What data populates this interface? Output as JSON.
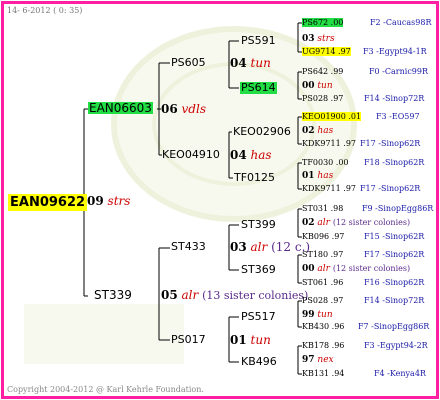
{
  "header": {
    "date": "14- 6-2012 ( 0: 35)"
  },
  "footer": {
    "copyright": "Copyright 2004-2012 @ Karl Kehrle Foundation."
  },
  "root": {
    "code": "EAN09622",
    "num": "09",
    "abbr": "strs"
  },
  "sire": {
    "code": "EAN06603",
    "num": "06",
    "abbr": "vdls"
  },
  "dam": {
    "code": "ST339",
    "num": "05",
    "abbr": "alr",
    "note": "(13 sister colonies)"
  },
  "ss": {
    "code": "PS605",
    "num": "04",
    "abbr": "tun"
  },
  "sd": {
    "code": "KEO04910",
    "num": "04",
    "abbr": "has"
  },
  "ds": {
    "code": "ST433",
    "num": "03",
    "abbr": "alr",
    "note": "(12 c.)"
  },
  "dd": {
    "code": "PS017",
    "num": "01",
    "abbr": "tun"
  },
  "g3": {
    "a": {
      "code": "PS591",
      "num": "03",
      "abbr": "strs"
    },
    "b": {
      "code": "PS614",
      "num": "00",
      "abbr": "tun"
    },
    "c": {
      "code": "KEO02906",
      "num": "02",
      "abbr": "has"
    },
    "d": {
      "code": "TF0125",
      "num": "01",
      "abbr": "has"
    },
    "e": {
      "code": "ST399",
      "num": "02",
      "abbr": "alr",
      "note": "(12 sister colonies)"
    },
    "f": {
      "code": "ST369",
      "num": "00",
      "abbr": "alr",
      "note": "(12 sister colonies)"
    },
    "g": {
      "code": "PS517",
      "num": "99",
      "abbr": "tun"
    },
    "h": {
      "code": "KB496",
      "num": "97",
      "abbr": "nex"
    }
  },
  "g4": [
    {
      "code": "PS672 .00",
      "info": "F2 -Caucas98R"
    },
    {
      "code": "UG9714 .97",
      "info": "F3 -Egypt94-1R"
    },
    {
      "code": "PS642 .99",
      "info": "F0 -Carnic99R"
    },
    {
      "code": "PS028 .97",
      "info": "F14 -Sinop72R"
    },
    {
      "code": "KEO01900 .01",
      "info": "F3 -EO597"
    },
    {
      "code": "KDK9711 .97",
      "info": "F17 -Sinop62R"
    },
    {
      "code": "TF0030 .00",
      "info": "F18 -Sinop62R"
    },
    {
      "code": "KDK9711 .97",
      "info": "F17 -Sinop62R"
    },
    {
      "code": "ST031 .98",
      "info": "F9 -SinopEgg86R"
    },
    {
      "code": "KB096 .97",
      "info": "F15 -Sinop62R"
    },
    {
      "code": "ST180 .97",
      "info": "F17 -Sinop62R"
    },
    {
      "code": "ST061 .96",
      "info": "F16 -Sinop62R"
    },
    {
      "code": "PS028 .97",
      "info": "F14 -Sinop72R"
    },
    {
      "code": "KB430 .96",
      "info": "F7 -SinopEgg86R"
    },
    {
      "code": "KB178 .96",
      "info": "F3 -Egypt94-2R"
    },
    {
      "code": "KB131 .94",
      "info": "F4 -Kenya4R"
    }
  ]
}
